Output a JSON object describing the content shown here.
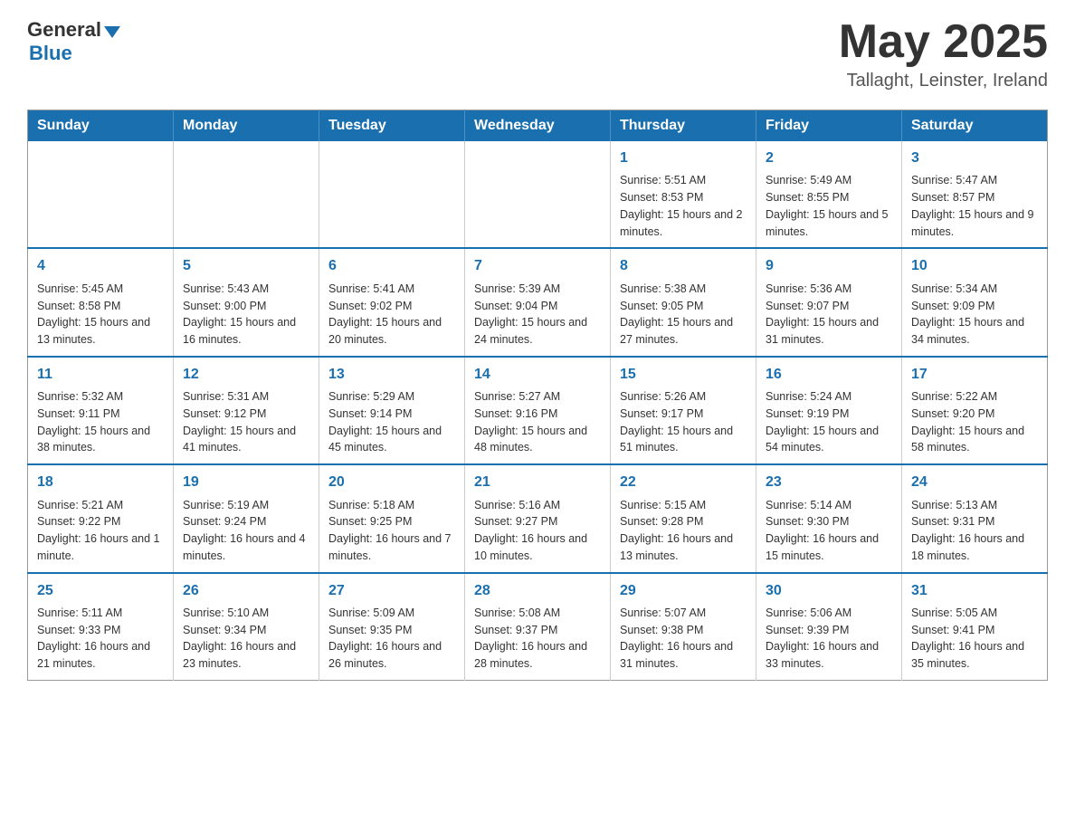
{
  "header": {
    "logo_general": "General",
    "logo_blue": "Blue",
    "month_title": "May 2025",
    "location": "Tallaght, Leinster, Ireland"
  },
  "days_of_week": [
    "Sunday",
    "Monday",
    "Tuesday",
    "Wednesday",
    "Thursday",
    "Friday",
    "Saturday"
  ],
  "weeks": [
    [
      {
        "day": "",
        "info": ""
      },
      {
        "day": "",
        "info": ""
      },
      {
        "day": "",
        "info": ""
      },
      {
        "day": "",
        "info": ""
      },
      {
        "day": "1",
        "info": "Sunrise: 5:51 AM\nSunset: 8:53 PM\nDaylight: 15 hours and 2 minutes."
      },
      {
        "day": "2",
        "info": "Sunrise: 5:49 AM\nSunset: 8:55 PM\nDaylight: 15 hours and 5 minutes."
      },
      {
        "day": "3",
        "info": "Sunrise: 5:47 AM\nSunset: 8:57 PM\nDaylight: 15 hours and 9 minutes."
      }
    ],
    [
      {
        "day": "4",
        "info": "Sunrise: 5:45 AM\nSunset: 8:58 PM\nDaylight: 15 hours and 13 minutes."
      },
      {
        "day": "5",
        "info": "Sunrise: 5:43 AM\nSunset: 9:00 PM\nDaylight: 15 hours and 16 minutes."
      },
      {
        "day": "6",
        "info": "Sunrise: 5:41 AM\nSunset: 9:02 PM\nDaylight: 15 hours and 20 minutes."
      },
      {
        "day": "7",
        "info": "Sunrise: 5:39 AM\nSunset: 9:04 PM\nDaylight: 15 hours and 24 minutes."
      },
      {
        "day": "8",
        "info": "Sunrise: 5:38 AM\nSunset: 9:05 PM\nDaylight: 15 hours and 27 minutes."
      },
      {
        "day": "9",
        "info": "Sunrise: 5:36 AM\nSunset: 9:07 PM\nDaylight: 15 hours and 31 minutes."
      },
      {
        "day": "10",
        "info": "Sunrise: 5:34 AM\nSunset: 9:09 PM\nDaylight: 15 hours and 34 minutes."
      }
    ],
    [
      {
        "day": "11",
        "info": "Sunrise: 5:32 AM\nSunset: 9:11 PM\nDaylight: 15 hours and 38 minutes."
      },
      {
        "day": "12",
        "info": "Sunrise: 5:31 AM\nSunset: 9:12 PM\nDaylight: 15 hours and 41 minutes."
      },
      {
        "day": "13",
        "info": "Sunrise: 5:29 AM\nSunset: 9:14 PM\nDaylight: 15 hours and 45 minutes."
      },
      {
        "day": "14",
        "info": "Sunrise: 5:27 AM\nSunset: 9:16 PM\nDaylight: 15 hours and 48 minutes."
      },
      {
        "day": "15",
        "info": "Sunrise: 5:26 AM\nSunset: 9:17 PM\nDaylight: 15 hours and 51 minutes."
      },
      {
        "day": "16",
        "info": "Sunrise: 5:24 AM\nSunset: 9:19 PM\nDaylight: 15 hours and 54 minutes."
      },
      {
        "day": "17",
        "info": "Sunrise: 5:22 AM\nSunset: 9:20 PM\nDaylight: 15 hours and 58 minutes."
      }
    ],
    [
      {
        "day": "18",
        "info": "Sunrise: 5:21 AM\nSunset: 9:22 PM\nDaylight: 16 hours and 1 minute."
      },
      {
        "day": "19",
        "info": "Sunrise: 5:19 AM\nSunset: 9:24 PM\nDaylight: 16 hours and 4 minutes."
      },
      {
        "day": "20",
        "info": "Sunrise: 5:18 AM\nSunset: 9:25 PM\nDaylight: 16 hours and 7 minutes."
      },
      {
        "day": "21",
        "info": "Sunrise: 5:16 AM\nSunset: 9:27 PM\nDaylight: 16 hours and 10 minutes."
      },
      {
        "day": "22",
        "info": "Sunrise: 5:15 AM\nSunset: 9:28 PM\nDaylight: 16 hours and 13 minutes."
      },
      {
        "day": "23",
        "info": "Sunrise: 5:14 AM\nSunset: 9:30 PM\nDaylight: 16 hours and 15 minutes."
      },
      {
        "day": "24",
        "info": "Sunrise: 5:13 AM\nSunset: 9:31 PM\nDaylight: 16 hours and 18 minutes."
      }
    ],
    [
      {
        "day": "25",
        "info": "Sunrise: 5:11 AM\nSunset: 9:33 PM\nDaylight: 16 hours and 21 minutes."
      },
      {
        "day": "26",
        "info": "Sunrise: 5:10 AM\nSunset: 9:34 PM\nDaylight: 16 hours and 23 minutes."
      },
      {
        "day": "27",
        "info": "Sunrise: 5:09 AM\nSunset: 9:35 PM\nDaylight: 16 hours and 26 minutes."
      },
      {
        "day": "28",
        "info": "Sunrise: 5:08 AM\nSunset: 9:37 PM\nDaylight: 16 hours and 28 minutes."
      },
      {
        "day": "29",
        "info": "Sunrise: 5:07 AM\nSunset: 9:38 PM\nDaylight: 16 hours and 31 minutes."
      },
      {
        "day": "30",
        "info": "Sunrise: 5:06 AM\nSunset: 9:39 PM\nDaylight: 16 hours and 33 minutes."
      },
      {
        "day": "31",
        "info": "Sunrise: 5:05 AM\nSunset: 9:41 PM\nDaylight: 16 hours and 35 minutes."
      }
    ]
  ]
}
